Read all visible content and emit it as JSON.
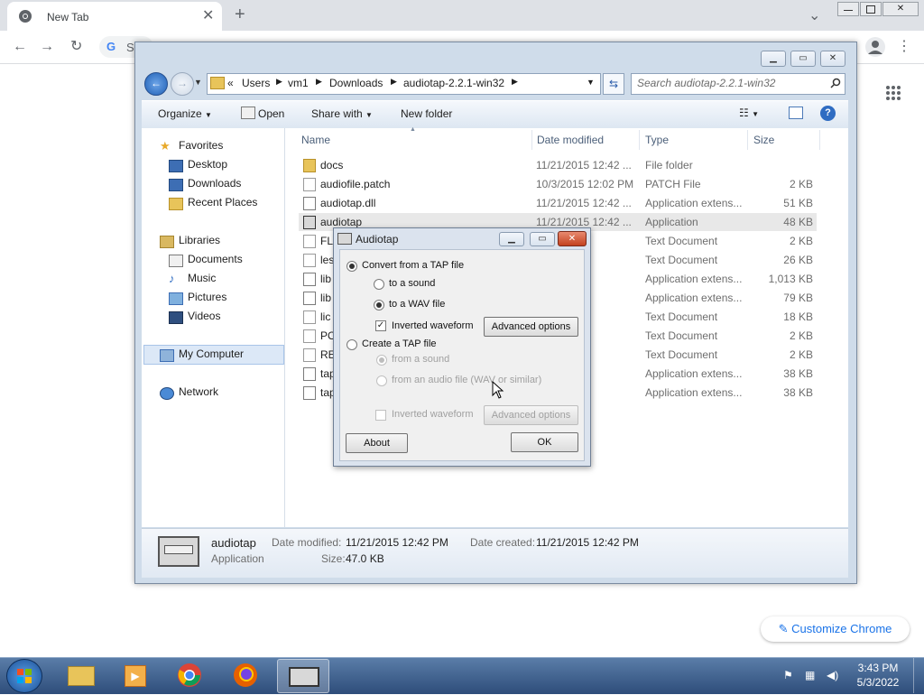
{
  "chrome": {
    "tab_title": "New Tab",
    "new_tab_symbol": "+",
    "omnibox_text": "S",
    "customize_label": "Customize Chrome"
  },
  "explorer": {
    "breadcrumb": [
      "«",
      "Users",
      "vm1",
      "Downloads",
      "audiotap-2.2.1-win32"
    ],
    "search_placeholder": "Search audiotap-2.2.1-win32",
    "toolbar": {
      "organize": "Organize",
      "open": "Open",
      "share_with": "Share with",
      "new_folder": "New folder"
    },
    "nav": {
      "favorites": "Favorites",
      "desktop": "Desktop",
      "downloads": "Downloads",
      "recent_places": "Recent Places",
      "libraries": "Libraries",
      "documents": "Documents",
      "music": "Music",
      "pictures": "Pictures",
      "videos": "Videos",
      "my_computer": "My Computer",
      "network": "Network"
    },
    "columns": {
      "name": "Name",
      "date": "Date modified",
      "type": "Type",
      "size": "Size"
    },
    "files": [
      {
        "name": "docs",
        "date": "11/21/2015 12:42 ...",
        "type": "File folder",
        "size": ""
      },
      {
        "name": "audiofile.patch",
        "date": "10/3/2015 12:02 PM",
        "type": "PATCH File",
        "size": "2 KB"
      },
      {
        "name": "audiotap.dll",
        "date": "11/21/2015 12:42 ...",
        "type": "Application extens...",
        "size": "51 KB"
      },
      {
        "name": "audiotap",
        "date": "11/21/2015 12:42 ...",
        "type": "Application",
        "size": "48 KB"
      },
      {
        "name": "FL",
        "date": "24 AM",
        "type": "Text Document",
        "size": "2 KB"
      },
      {
        "name": "les",
        "date": "10:18 ...",
        "type": "Text Document",
        "size": "26 KB"
      },
      {
        "name": "lib",
        "date": "12:42 ...",
        "type": "Application extens...",
        "size": "1,013 KB"
      },
      {
        "name": "lib",
        "date": "12:42 ...",
        "type": "Application extens...",
        "size": "79 KB"
      },
      {
        "name": "lic",
        "date": "10:17 ...",
        "type": "Text Document",
        "size": "18 KB"
      },
      {
        "name": "PO",
        "date": "10:14 ...",
        "type": "Text Document",
        "size": "2 KB"
      },
      {
        "name": "RE",
        "date": "2:19 PM",
        "type": "Text Document",
        "size": "2 KB"
      },
      {
        "name": "tap",
        "date": "12:42 ...",
        "type": "Application extens...",
        "size": "38 KB"
      },
      {
        "name": "tap",
        "date": "12:42 ...",
        "type": "Application extens...",
        "size": "38 KB"
      }
    ],
    "details": {
      "name": "audiotap",
      "kind": "Application",
      "modified_label": "Date modified:",
      "modified_value": "11/21/2015 12:42 PM",
      "created_label": "Date created:",
      "created_value": "11/21/2015 12:42 PM",
      "size_label": "Size:",
      "size_value": "47.0 KB"
    }
  },
  "dialog": {
    "title": "Audiotap",
    "convert_from_tap": "Convert from a TAP file",
    "to_sound": "to a sound",
    "to_wav": "to a WAV file",
    "inverted_waveform": "Inverted waveform",
    "advanced_options": "Advanced options",
    "create_tap": "Create a TAP file",
    "from_sound": "from a sound",
    "from_audio_file": "from an audio file (WAV or similar)",
    "inverted_waveform_2": "Inverted waveform",
    "advanced_options_2": "Advanced options",
    "about": "About",
    "ok": "OK"
  },
  "taskbar": {
    "time": "3:43 PM",
    "date": "5/3/2022"
  }
}
